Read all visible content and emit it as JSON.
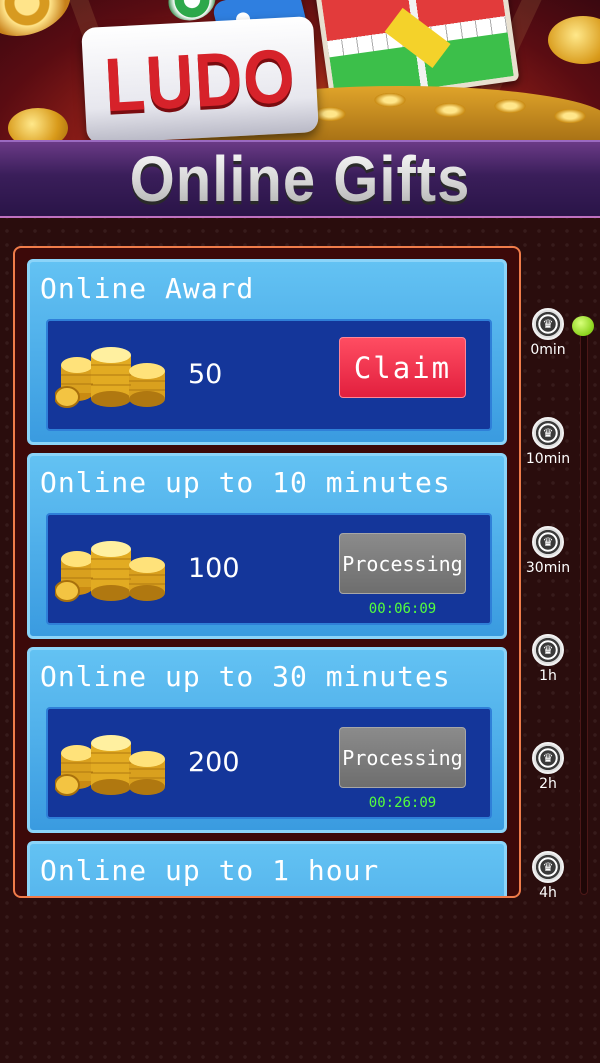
{
  "banner": {
    "logo_text": "LUDO"
  },
  "header": {
    "title": "Online Gifts"
  },
  "gifts": [
    {
      "title": "Online Award",
      "amount": "50",
      "action": "Claim",
      "state": "claimable"
    },
    {
      "title": "Online up to 10 minutes",
      "amount": "100",
      "action": "Processing",
      "state": "processing",
      "timer": "00:06:09"
    },
    {
      "title": "Online up to 30 minutes",
      "amount": "200",
      "action": "Processing",
      "state": "processing",
      "timer": "00:26:09"
    },
    {
      "title": "Online up to 1 hour"
    }
  ],
  "timeline": {
    "marks": [
      "0min",
      "10min",
      "30min",
      "1h",
      "2h",
      "4h"
    ],
    "current_mark": "0min",
    "icon": "crown-chip-icon"
  },
  "colors": {
    "claim": "#e8284a",
    "processing": "#7a7a7a",
    "timer": "#54ff3c",
    "card": "#4aa8ea",
    "card_inner": "#14369a",
    "progress_knob": "#9be22a"
  }
}
